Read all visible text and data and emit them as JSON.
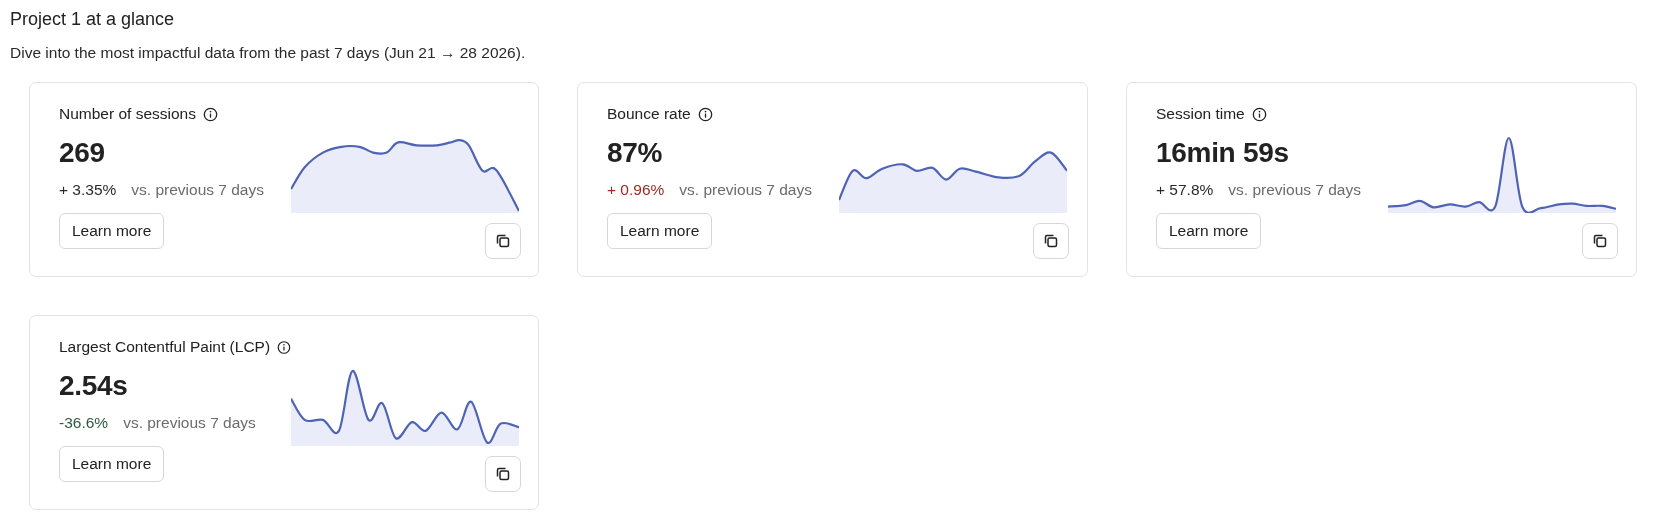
{
  "header": {
    "title": "Project 1 at a glance",
    "subtitle": "Dive into the most impactful data from the past 7 days (Jun 21 → 28 2026)."
  },
  "cards": [
    {
      "title": "Number of sessions",
      "value": "269",
      "delta": "+ 3.35%",
      "color": "#2a2a2a",
      "comparison": "vs. previous 7 days",
      "button": "Learn more"
    },
    {
      "title": "Bounce rate",
      "value": "87%",
      "delta": "+ 0.96%",
      "color": "#9b2b1e",
      "comparison": "vs. previous 7 days",
      "button": "Learn more"
    },
    {
      "title": "Session time",
      "value": "16min 59s",
      "delta": "+ 57.8%",
      "color": "#2a2a2a",
      "comparison": "vs. previous 7 days",
      "button": "Learn more"
    },
    {
      "title": "Largest Contentful Paint (LCP)",
      "value": "2.54s",
      "delta": "-36.6%",
      "color": "#2f5a45",
      "comparison": "vs. previous 7 days",
      "button": "Learn more"
    }
  ]
}
